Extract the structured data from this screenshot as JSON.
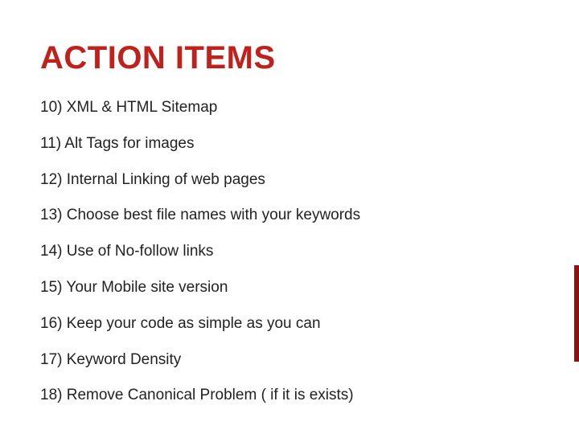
{
  "title": "ACTION ITEMS",
  "items": [
    "10) XML & HTML Sitemap",
    "11) Alt Tags for images",
    "12) Internal Linking of web pages",
    "13) Choose best file names with your keywords",
    "14) Use of No-follow links",
    "15) Your Mobile site version",
    "16) Keep your code as simple as you can",
    "17) Keyword Density",
    "18) Remove Canonical Problem ( if it is exists)"
  ]
}
